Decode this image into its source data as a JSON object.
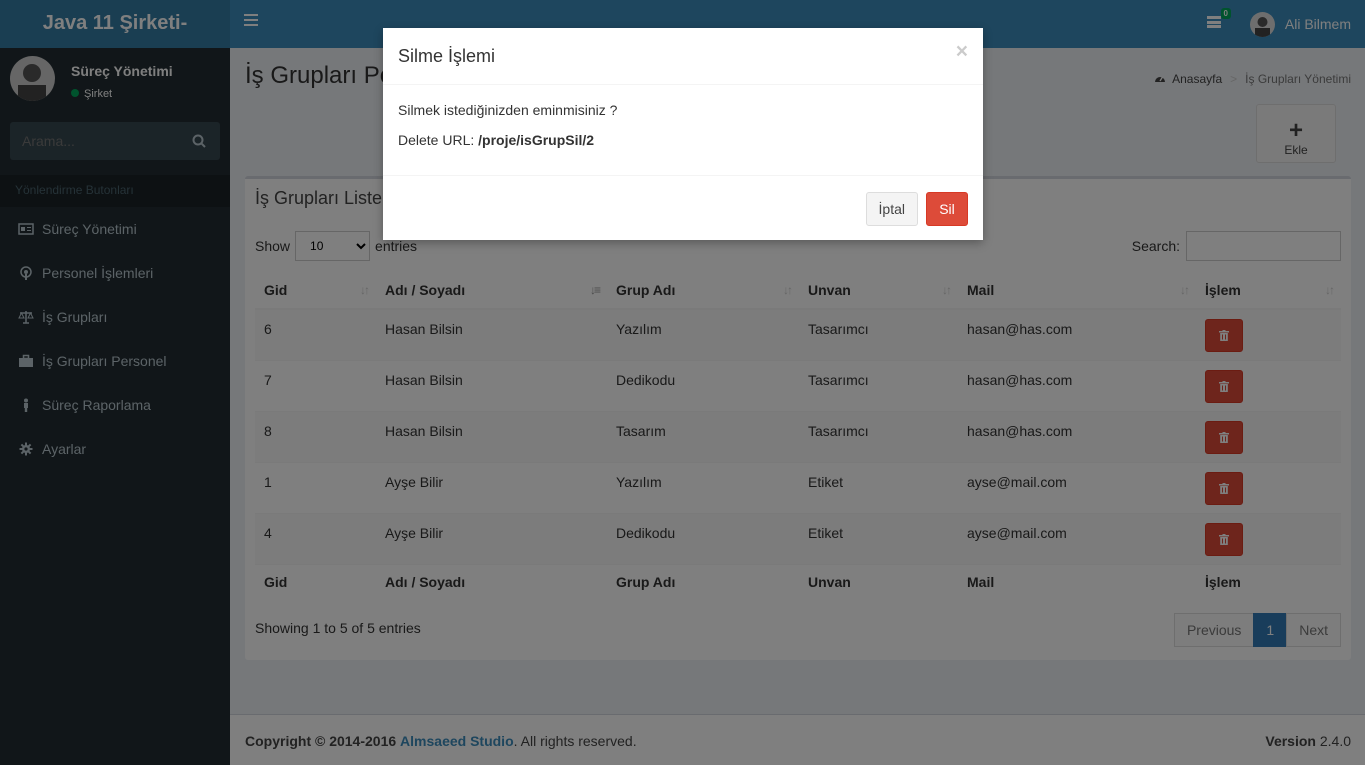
{
  "app": {
    "logo": "Java 11 Şirketi-"
  },
  "navbar": {
    "notification_count": "0",
    "user_name": "Ali Bilmem"
  },
  "sidebar": {
    "user_name": "Süreç Yönetimi",
    "user_status": "Şirket",
    "search_placeholder": "Arama...",
    "section_header": "Yönlendirme Butonları",
    "items": [
      {
        "label": "Süreç Yönetimi",
        "icon": "id-card-icon"
      },
      {
        "label": "Personel İşlemleri",
        "icon": "podcast-icon"
      },
      {
        "label": "İş Grupları",
        "icon": "balance-scale-icon"
      },
      {
        "label": "İş Grupları Personel",
        "icon": "briefcase-icon"
      },
      {
        "label": "Süreç Raporlama",
        "icon": "street-view-icon"
      },
      {
        "label": "Ayarlar",
        "icon": "gear-icon"
      }
    ]
  },
  "page": {
    "title": "İş Grupları Pe",
    "breadcrumb": {
      "home": "Anasayfa",
      "current": "İş Grupları Yönetimi"
    },
    "add_label": "Ekle"
  },
  "box": {
    "title": "İş Grupları Liste",
    "show_label": "Show",
    "page_size": "10",
    "entries_label": "entries",
    "search_label": "Search:",
    "columns": [
      "Gid",
      "Adı / Soyadı",
      "Grup Adı",
      "Unvan",
      "Mail",
      "İşlem"
    ],
    "rows": [
      {
        "gid": "6",
        "name": "Hasan Bilsin",
        "group": "Yazılım",
        "title": "Tasarımcı",
        "mail": "hasan@has.com"
      },
      {
        "gid": "7",
        "name": "Hasan Bilsin",
        "group": "Dedikodu",
        "title": "Tasarımcı",
        "mail": "hasan@has.com"
      },
      {
        "gid": "8",
        "name": "Hasan Bilsin",
        "group": "Tasarım",
        "title": "Tasarımcı",
        "mail": "hasan@has.com"
      },
      {
        "gid": "1",
        "name": "Ayşe Bilir",
        "group": "Yazılım",
        "title": "Etiket",
        "mail": "ayse@mail.com"
      },
      {
        "gid": "4",
        "name": "Ayşe Bilir",
        "group": "Dedikodu",
        "title": "Etiket",
        "mail": "ayse@mail.com"
      }
    ],
    "info": "Showing 1 to 5 of 5 entries",
    "pager": {
      "prev": "Previous",
      "page": "1",
      "next": "Next"
    }
  },
  "footer": {
    "copyright": "Copyright © 2014-2016",
    "studio": "Almsaeed Studio",
    "rights": ". All rights reserved.",
    "version_label": "Version",
    "version": "2.4.0"
  },
  "modal": {
    "title": "Silme İşlemi",
    "close": "×",
    "question": "Silmek istediğinizden eminmisiniz ?",
    "url_label": "Delete URL:",
    "url": "/proje/isGrupSil/2",
    "cancel": "İptal",
    "confirm": "Sil"
  },
  "colors": {
    "brand": "#3c8dbc",
    "brand_dark": "#357ca5",
    "sidebar": "#222d32",
    "danger": "#dd4b39",
    "success": "#00a65a"
  }
}
